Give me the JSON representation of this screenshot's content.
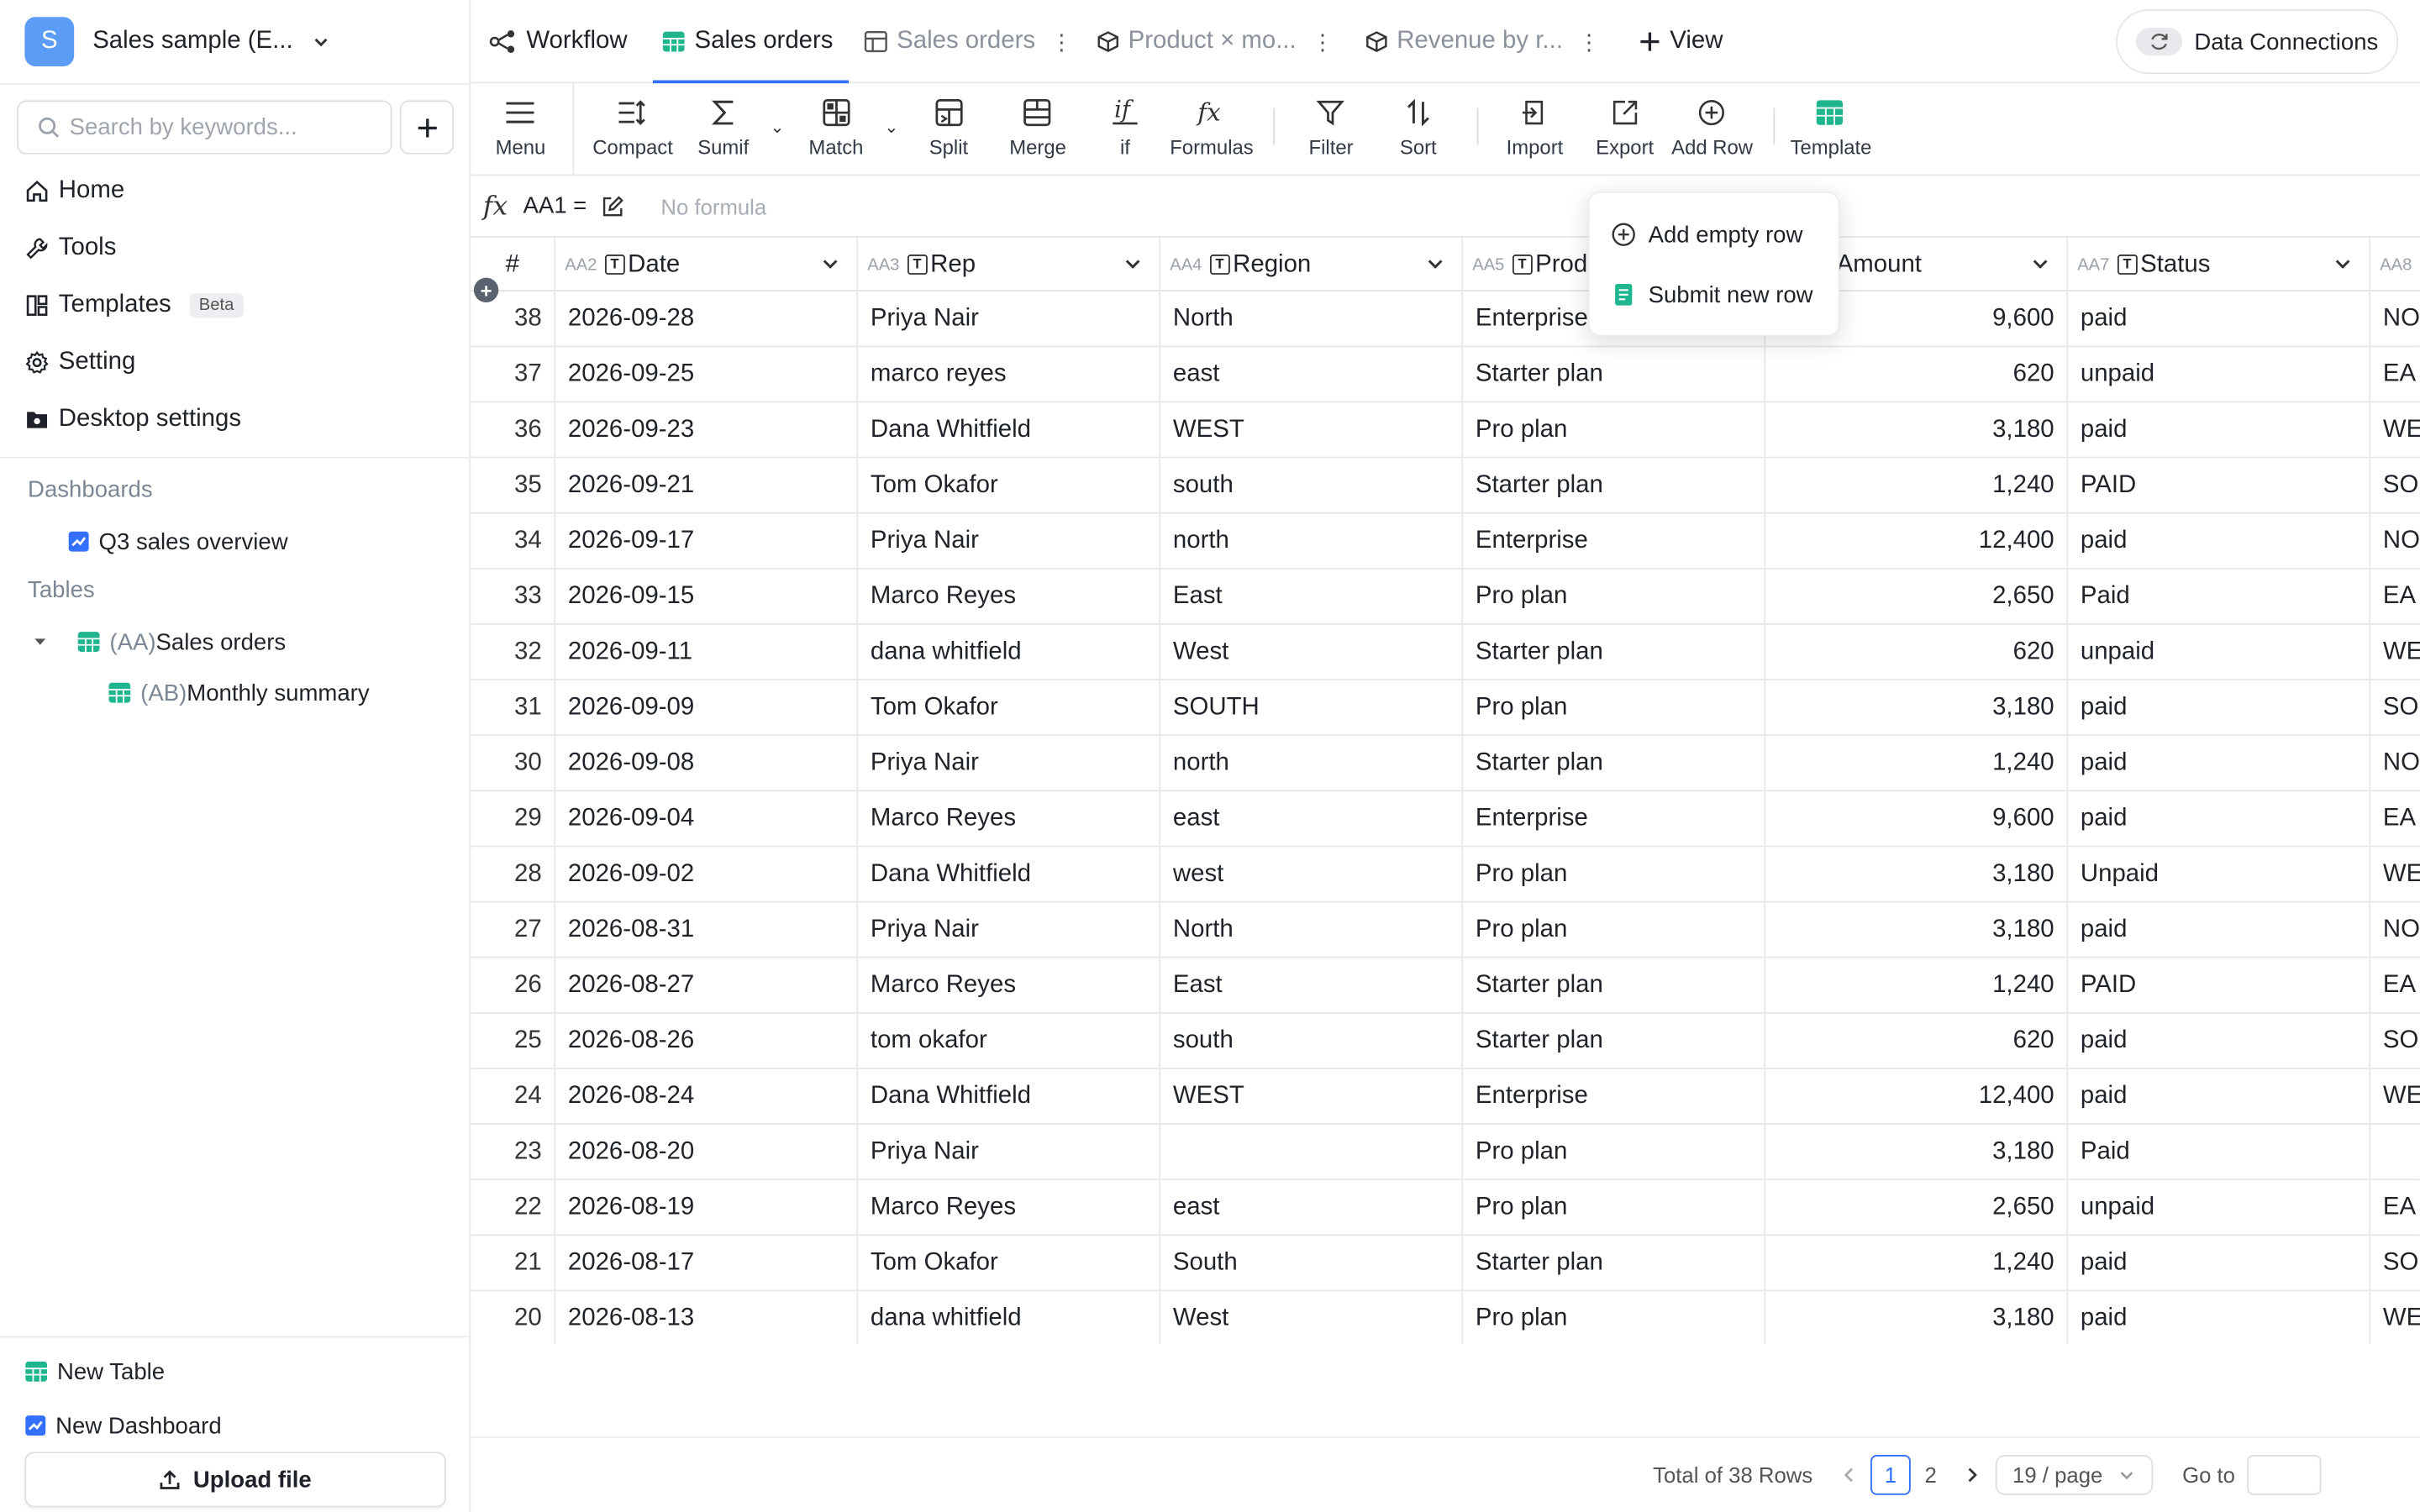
{
  "workspace": {
    "initial": "S",
    "name": "Sales sample (E..."
  },
  "sidebar": {
    "search_placeholder": "Search by keywords...",
    "nav": [
      {
        "label": "Home",
        "icon": "home-icon"
      },
      {
        "label": "Tools",
        "icon": "tools-icon"
      },
      {
        "label": "Templates",
        "icon": "templates-icon",
        "badge": "Beta"
      },
      {
        "label": "Setting",
        "icon": "gear-icon"
      },
      {
        "label": "Desktop settings",
        "icon": "desktop-settings-icon"
      }
    ],
    "dashboards_title": "Dashboards",
    "dashboards": [
      {
        "label": "Q3 sales overview"
      }
    ],
    "tables_title": "Tables",
    "tables": [
      {
        "prefix": "(AA)",
        "label": "Sales orders"
      },
      {
        "prefix": "(AB)",
        "label": "Monthly summary"
      }
    ],
    "new_table": "New Table",
    "new_dashboard": "New Dashboard",
    "upload": "Upload file"
  },
  "tabs": [
    {
      "label": "Workflow"
    },
    {
      "label": "Sales orders"
    },
    {
      "label": "Sales orders"
    },
    {
      "label": "Product × mo..."
    },
    {
      "label": "Revenue by r..."
    }
  ],
  "view_label": "View",
  "data_connections": "Data Connections",
  "toolbar": {
    "menu": "Menu",
    "compact": "Compact",
    "sumif": "Sumif",
    "match": "Match",
    "split": "Split",
    "merge": "Merge",
    "if": "if",
    "formulas": "Formulas",
    "filter": "Filter",
    "sort": "Sort",
    "import": "Import",
    "export": "Export",
    "add_row": "Add Row",
    "template": "Template"
  },
  "formula": {
    "cell_ref": "AA1 =",
    "placeholder": "No formula"
  },
  "add_row_menu": {
    "add_empty": "Add empty row",
    "submit_new": "Submit new row"
  },
  "columns": [
    {
      "id": "",
      "label": "#"
    },
    {
      "id": "AA2",
      "label": "Date"
    },
    {
      "id": "AA3",
      "label": "Rep"
    },
    {
      "id": "AA4",
      "label": "Region"
    },
    {
      "id": "AA5",
      "label": "Produ"
    },
    {
      "id": "",
      "label": "Amount"
    },
    {
      "id": "AA7",
      "label": "Status"
    },
    {
      "id": "AA8",
      "label": ""
    }
  ],
  "rows": [
    [
      "38",
      "2026-09-28",
      "Priya Nair",
      "North",
      "Enterprise",
      "9,600",
      "paid",
      "NO"
    ],
    [
      "37",
      "2026-09-25",
      "marco reyes",
      "east",
      "Starter plan",
      "620",
      "unpaid",
      "EA"
    ],
    [
      "36",
      "2026-09-23",
      "Dana Whitfield",
      "WEST",
      "Pro plan",
      "3,180",
      "paid",
      "WE"
    ],
    [
      "35",
      "2026-09-21",
      "Tom Okafor",
      "south",
      "Starter plan",
      "1,240",
      "PAID",
      "SO"
    ],
    [
      "34",
      "2026-09-17",
      "Priya Nair",
      "north",
      "Enterprise",
      "12,400",
      "paid",
      "NO"
    ],
    [
      "33",
      "2026-09-15",
      "Marco Reyes",
      "East",
      "Pro plan",
      "2,650",
      "Paid",
      "EA"
    ],
    [
      "32",
      "2026-09-11",
      "dana whitfield",
      "West",
      "Starter plan",
      "620",
      "unpaid",
      "WE"
    ],
    [
      "31",
      "2026-09-09",
      "Tom Okafor",
      "SOUTH",
      "Pro plan",
      "3,180",
      "paid",
      "SO"
    ],
    [
      "30",
      "2026-09-08",
      "Priya Nair",
      "north",
      "Starter plan",
      "1,240",
      "paid",
      "NO"
    ],
    [
      "29",
      "2026-09-04",
      "Marco Reyes",
      "east",
      "Enterprise",
      "9,600",
      "paid",
      "EA"
    ],
    [
      "28",
      "2026-09-02",
      "Dana Whitfield",
      "west",
      "Pro plan",
      "3,180",
      "Unpaid",
      "WE"
    ],
    [
      "27",
      "2026-08-31",
      "Priya Nair",
      "North",
      "Pro plan",
      "3,180",
      "paid",
      "NO"
    ],
    [
      "26",
      "2026-08-27",
      "Marco Reyes",
      "East",
      "Starter plan",
      "1,240",
      "PAID",
      "EA"
    ],
    [
      "25",
      "2026-08-26",
      "tom okafor",
      "south",
      "Starter plan",
      "620",
      "paid",
      "SO"
    ],
    [
      "24",
      "2026-08-24",
      "Dana Whitfield",
      "WEST",
      "Enterprise",
      "12,400",
      "paid",
      "WE"
    ],
    [
      "23",
      "2026-08-20",
      "Priya Nair",
      "",
      "Pro plan",
      "3,180",
      "Paid",
      ""
    ],
    [
      "22",
      "2026-08-19",
      "Marco Reyes",
      "east",
      "Pro plan",
      "2,650",
      "unpaid",
      "EA"
    ],
    [
      "21",
      "2026-08-17",
      "Tom Okafor",
      "South",
      "Starter plan",
      "1,240",
      "paid",
      "SO"
    ],
    [
      "20",
      "2026-08-13",
      "dana whitfield",
      "West",
      "Pro plan",
      "3,180",
      "paid",
      "WE"
    ]
  ],
  "footer": {
    "total": "Total of 38 Rows",
    "pages": [
      "1",
      "2"
    ],
    "current_page": "1",
    "per_page": "19 / page",
    "goto": "Go to"
  },
  "colors": {
    "accent": "#3370ff",
    "avatar": "#5b9cf6",
    "sheet_green": "#1fb58f"
  }
}
